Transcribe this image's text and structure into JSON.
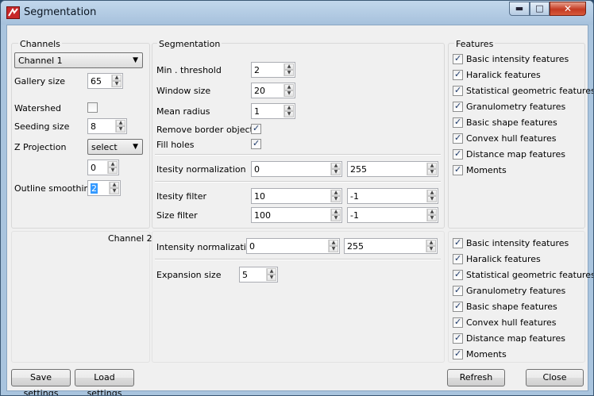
{
  "window": {
    "title": "Segmentation",
    "min_glyph": "▬",
    "max_glyph": "□",
    "close_glyph": "✕"
  },
  "channels": {
    "header": "Channels",
    "channel_select": "Channel 1",
    "gallery_size_label": "Gallery size",
    "gallery_size": "65",
    "watershed_label": "Watershed",
    "watershed_checked": false,
    "seeding_size_label": "Seeding size",
    "seeding_size": "8",
    "z_projection_label": "Z Projection",
    "z_projection_select": "select",
    "z_projection_value": "0",
    "outline_smoothing_label": "Outline smoothing",
    "outline_smoothing": "2"
  },
  "segmentation": {
    "header": "Segmentation",
    "min_threshold_label": "Min . threshold",
    "min_threshold": "2",
    "window_size_label": "Window size",
    "window_size": "20",
    "mean_radius_label": "Mean radius",
    "mean_radius": "1",
    "remove_border_label": "Remove border objects",
    "remove_border_checked": true,
    "fill_holes_label": "Fill holes",
    "fill_holes_checked": true,
    "intensity_norm_label": "Itesity normalization",
    "intensity_norm_min": "0",
    "intensity_norm_max": "255",
    "intensity_filter_label": "Itesity filter",
    "intensity_filter_min": "10",
    "intensity_filter_max": "-1",
    "size_filter_label": "Size filter",
    "size_filter_min": "100",
    "size_filter_max": "-1"
  },
  "features": {
    "header": "Features",
    "items": [
      {
        "label": "Basic intensity features",
        "checked": true
      },
      {
        "label": "Haralick features",
        "checked": true
      },
      {
        "label": "Statistical geometric features",
        "checked": true
      },
      {
        "label": "Granulometry features",
        "checked": true
      },
      {
        "label": "Basic shape features",
        "checked": true
      },
      {
        "label": "Convex hull features",
        "checked": true
      },
      {
        "label": "Distance map features",
        "checked": true
      },
      {
        "label": "Moments",
        "checked": true
      }
    ]
  },
  "channel2": {
    "label": "Channel 2",
    "intensity_norm_label": "Intensity normalization",
    "intensity_norm_min": "0",
    "intensity_norm_max": "255",
    "expansion_size_label": "Expansion size",
    "expansion_size": "5",
    "features": [
      {
        "label": "Basic intensity features",
        "checked": true
      },
      {
        "label": "Haralick features",
        "checked": true
      },
      {
        "label": "Statistical geometric features",
        "checked": true
      },
      {
        "label": "Granulometry features",
        "checked": true
      },
      {
        "label": "Basic shape features",
        "checked": true
      },
      {
        "label": "Convex hull features",
        "checked": true
      },
      {
        "label": "Distance map features",
        "checked": true
      },
      {
        "label": "Moments",
        "checked": true
      }
    ]
  },
  "buttons": {
    "save": "Save settings",
    "load": "Load settings",
    "refresh": "Refresh",
    "close": "Close"
  },
  "glyphs": {
    "up": "▲",
    "down": "▼",
    "caret": "▼",
    "check": "✓"
  }
}
